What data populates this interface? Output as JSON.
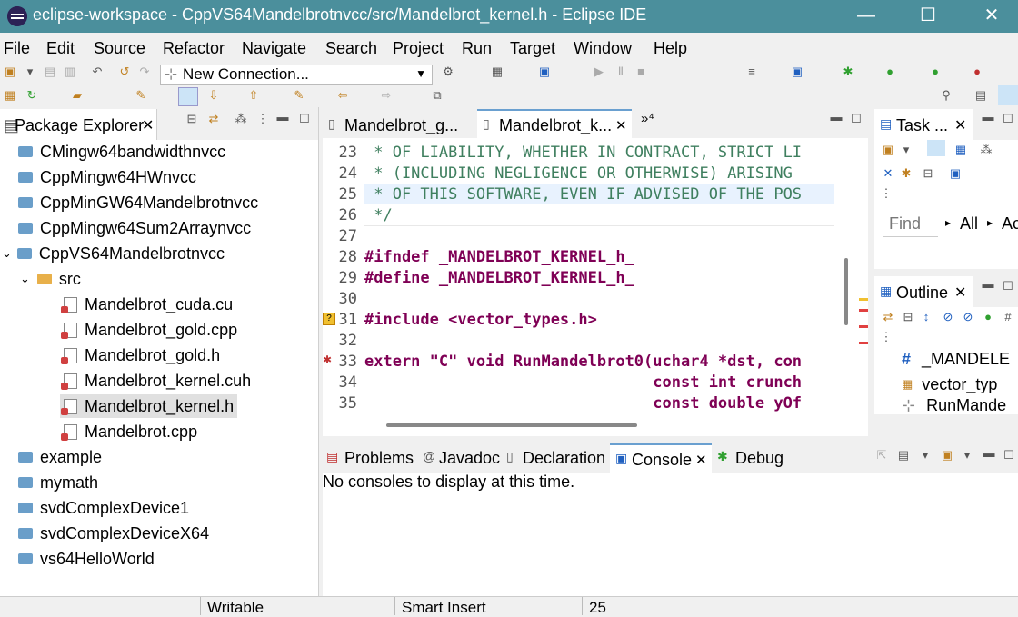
{
  "window": {
    "title": "eclipse-workspace - CppVS64Mandelbrotnvcc/src/Mandelbrot_kernel.h - Eclipse IDE",
    "min": "—",
    "max": "☐",
    "close": "✕"
  },
  "menu": [
    "File",
    "Edit",
    "Source",
    "Refactor",
    "Navigate",
    "Search",
    "Project",
    "Run",
    "Target",
    "Window",
    "Help"
  ],
  "toolbar": {
    "connection": "New Connection..."
  },
  "package_explorer": {
    "tab": "Package Explorer",
    "items": [
      "CMingw64bandwidthnvcc",
      "CppMingw64HWnvcc",
      "CppMinGW64Mandelbrotnvcc",
      "CppMingw64Sum2Arraynvcc",
      "CppVS64Mandelbrotnvcc",
      "src",
      "Mandelbrot_cuda.cu",
      "Mandelbrot_gold.cpp",
      "Mandelbrot_gold.h",
      "Mandelbrot_kernel.cuh",
      "Mandelbrot_kernel.h",
      "Mandelbrot.cpp",
      "example",
      "mymath",
      "svdComplexDevice1",
      "svdComplexDeviceX64",
      "vs64HelloWorld"
    ]
  },
  "editor": {
    "tabs": [
      "Mandelbrot_g...",
      "Mandelbrot_k...",
      "»⁴"
    ],
    "lines": [
      {
        "n": "23",
        "t": " * OF LIABILITY, WHETHER IN CONTRACT, STRICT LI"
      },
      {
        "n": "24",
        "t": " * (INCLUDING NEGLIGENCE OR OTHERWISE) ARISING"
      },
      {
        "n": "25",
        "t": " * OF THIS SOFTWARE, EVEN IF ADVISED OF THE POS"
      },
      {
        "n": "26",
        "t": " */"
      },
      {
        "n": "27",
        "t": ""
      },
      {
        "n": "28",
        "t": "#ifndef _MANDELBROT_KERNEL_h_"
      },
      {
        "n": "29",
        "t": "#define _MANDELBROT_KERNEL_h_"
      },
      {
        "n": "30",
        "t": ""
      },
      {
        "n": "31",
        "t": "#include <vector_types.h>"
      },
      {
        "n": "32",
        "t": ""
      },
      {
        "n": "33",
        "t": "extern \"C\" void RunMandelbrot0(uchar4 *dst, con"
      },
      {
        "n": "34",
        "t": "                               const int crunch"
      },
      {
        "n": "35",
        "t": "                               const double yOf"
      }
    ]
  },
  "task_panel": {
    "tab": "Task ...",
    "find": "Find",
    "all": "All",
    "acti": "Ac"
  },
  "outline": {
    "tab": "Outline",
    "items": [
      "_MANDELE",
      "vector_typ",
      "RunMande"
    ]
  },
  "bottom": {
    "tabs": [
      "Problems",
      "Javadoc",
      "Declaration",
      "Console",
      "Debug"
    ],
    "message": "No consoles to display at this time."
  },
  "status": {
    "writable": "Writable",
    "insert": "Smart Insert",
    "pos": "25"
  }
}
